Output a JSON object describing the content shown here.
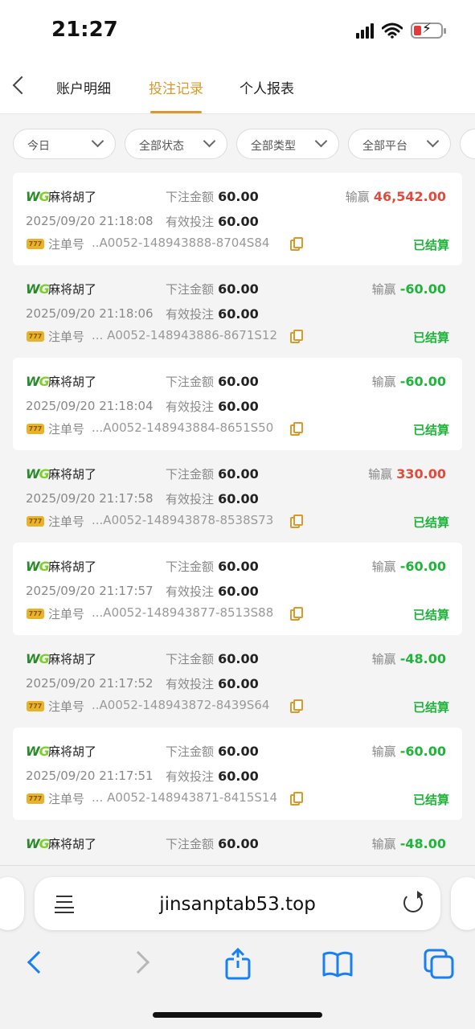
{
  "status_bar": {
    "time": "21:27"
  },
  "nav": {
    "tabs": [
      {
        "label": "账户明细",
        "active": false
      },
      {
        "label": "投注记录",
        "active": true
      },
      {
        "label": "个人报表",
        "active": false
      }
    ],
    "accent_color": "#d99a2b"
  },
  "filters": [
    {
      "label": "今日"
    },
    {
      "label": "全部状态"
    },
    {
      "label": "全部类型"
    },
    {
      "label": "全部平台"
    }
  ],
  "labels": {
    "bet_amount": "下注金额",
    "valid_bet": "有效投注",
    "win_loss": "输赢",
    "order_no": "注单号",
    "settled": "已结算",
    "provider_w": "W",
    "provider_g": "G",
    "coin_text": "777"
  },
  "records": [
    {
      "game": "麻将胡了",
      "bet": "60.00",
      "valid": "60.00",
      "datetime": "2025/09/20 21:18:08",
      "order": "..A0052-148943888-8704S84",
      "result": "46,542.00",
      "result_type": "win",
      "status": "已结算"
    },
    {
      "game": "麻将胡了",
      "bet": "60.00",
      "valid": "60.00",
      "datetime": "2025/09/20 21:18:06",
      "order": "... A0052-148943886-8671S12",
      "result": "-60.00",
      "result_type": "lose",
      "status": "已结算"
    },
    {
      "game": "麻将胡了",
      "bet": "60.00",
      "valid": "60.00",
      "datetime": "2025/09/20 21:18:04",
      "order": "...A0052-148943884-8651S50",
      "result": "-60.00",
      "result_type": "lose",
      "status": "已结算"
    },
    {
      "game": "麻将胡了",
      "bet": "60.00",
      "valid": "60.00",
      "datetime": "2025/09/20 21:17:58",
      "order": "...A0052-148943878-8538S73",
      "result": "330.00",
      "result_type": "win",
      "status": "已结算"
    },
    {
      "game": "麻将胡了",
      "bet": "60.00",
      "valid": "60.00",
      "datetime": "2025/09/20 21:17:57",
      "order": "...A0052-148943877-8513S88",
      "result": "-60.00",
      "result_type": "lose",
      "status": "已结算"
    },
    {
      "game": "麻将胡了",
      "bet": "60.00",
      "valid": "60.00",
      "datetime": "2025/09/20 21:17:52",
      "order": "..A0052-148943872-8439S64",
      "result": "-48.00",
      "result_type": "lose",
      "status": "已结算"
    },
    {
      "game": "麻将胡了",
      "bet": "60.00",
      "valid": "60.00",
      "datetime": "2025/09/20 21:17:51",
      "order": "... A0052-148943871-8415S14",
      "result": "-60.00",
      "result_type": "lose",
      "status": "已结算"
    },
    {
      "game": "麻将胡了",
      "bet": "60.00",
      "valid": "",
      "datetime": "",
      "order": "",
      "result": "-48.00",
      "result_type": "lose",
      "status": ""
    }
  ],
  "browser": {
    "url": "jinsanptab53.top",
    "icons": [
      "page-menu-icon",
      "reload-icon",
      "back-icon",
      "forward-icon",
      "share-icon",
      "bookmarks-icon",
      "tabs-icon"
    ]
  },
  "colors": {
    "win": "#e04c3c",
    "lose": "#1fb53a",
    "settled": "#1fb53a"
  }
}
